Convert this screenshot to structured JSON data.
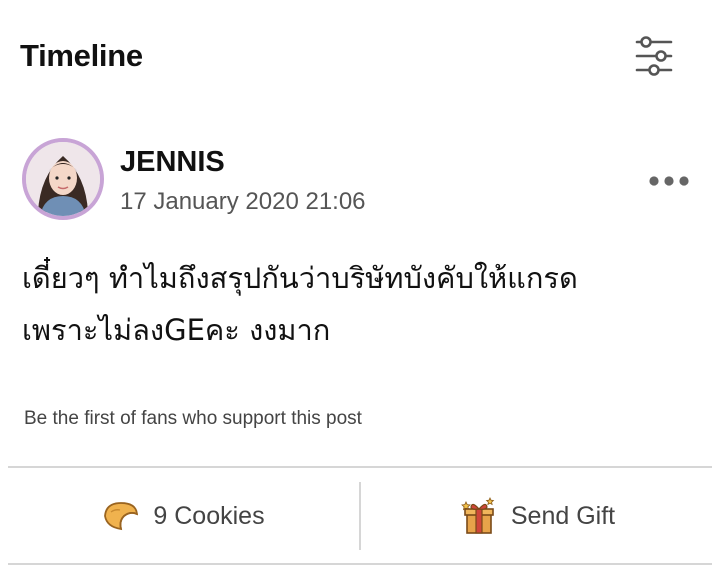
{
  "header": {
    "title": "Timeline",
    "filter_icon": "sliders-icon"
  },
  "post": {
    "author": "JENNIS",
    "timestamp": "17 January 2020 21:06",
    "text_line1": "เดี๋ยวๆ ทำไมถึงสรุปกันว่าบริษัทบังคับให้แกรด",
    "text_line2": "เพราะไม่ลงGEคะ งงมาก",
    "support_text": "Be the first of fans who support this post",
    "more_icon": "more-dots-icon"
  },
  "actions": {
    "cookies_label": "9 Cookies",
    "cookies_icon": "fortune-cookie-icon",
    "gift_label": "Send Gift",
    "gift_icon": "gift-box-icon"
  },
  "colors": {
    "avatar_ring": "#c8a4d6",
    "divider": "#d6d6d6",
    "cookie": "#e9a94a",
    "gift": "#c98a3a"
  }
}
